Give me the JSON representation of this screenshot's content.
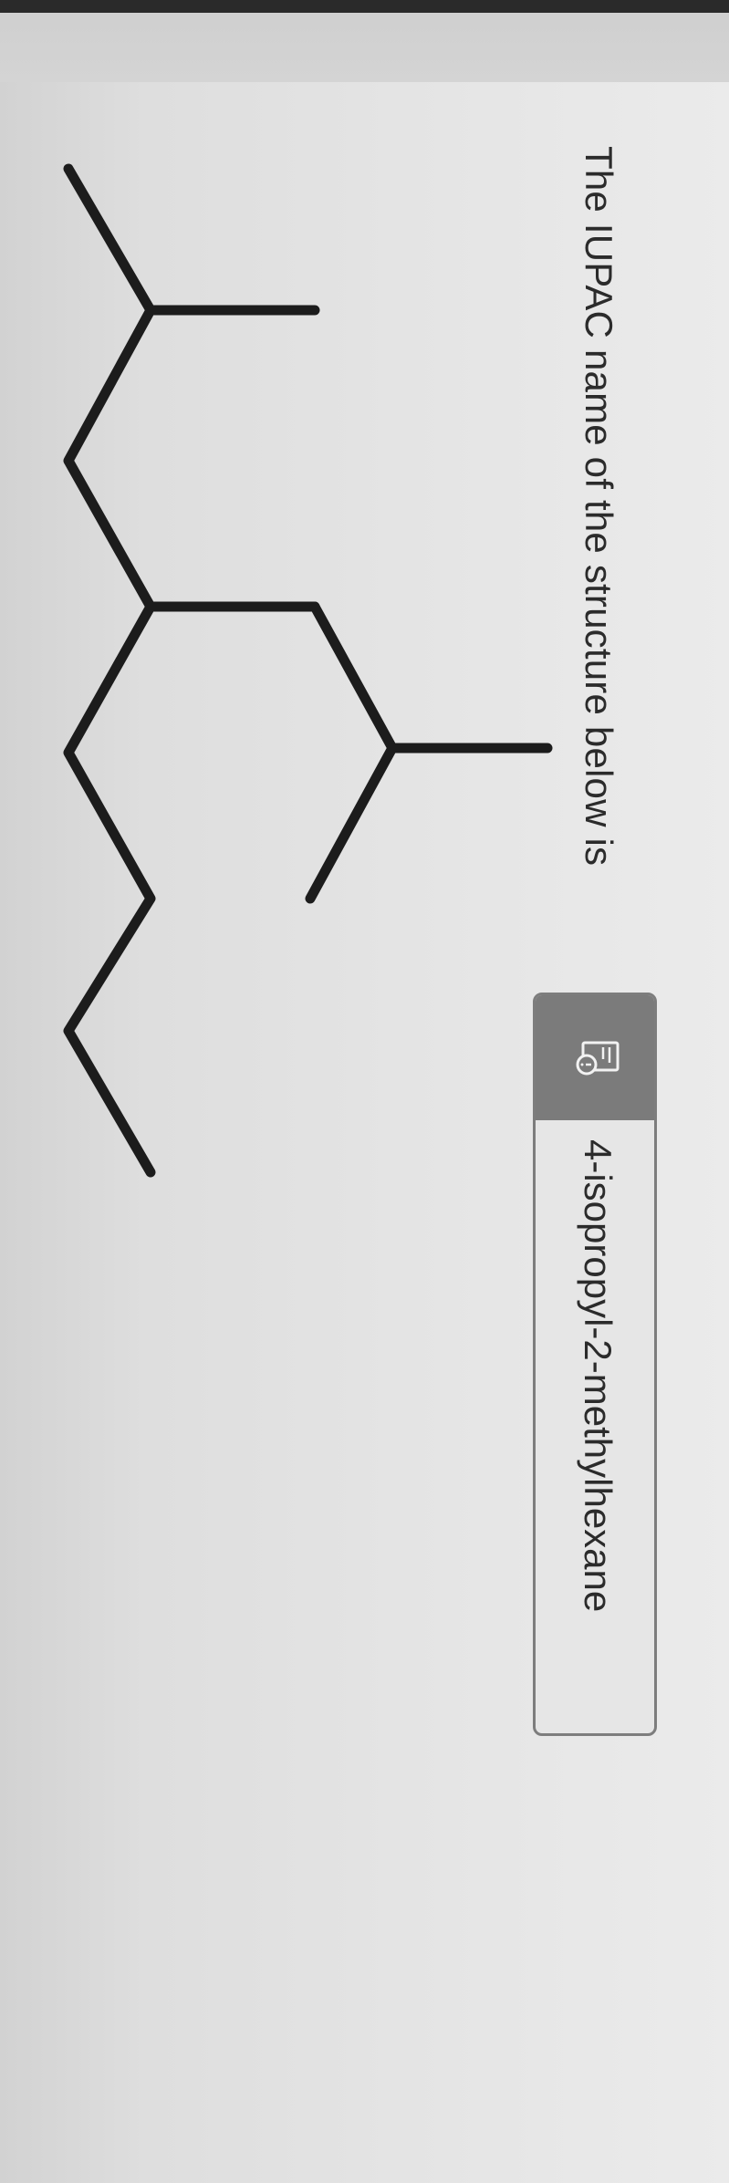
{
  "question": {
    "text": "The IUPAC name of the structure below is"
  },
  "answer": {
    "value": "4-isopropyl-2-methylhexane",
    "icon": "document-info-icon"
  },
  "structure": {
    "icon": "skeletal-structure"
  }
}
